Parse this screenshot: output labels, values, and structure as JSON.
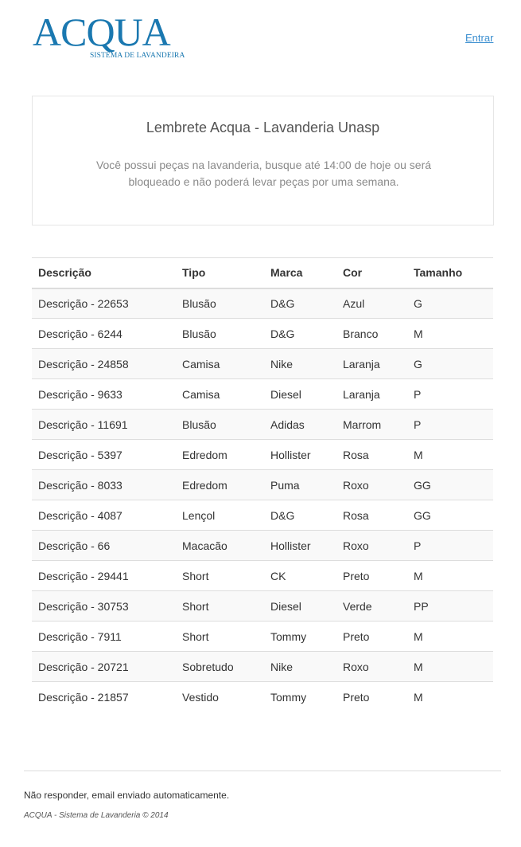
{
  "header": {
    "logo_text": "ACQUA",
    "logo_subtitle": "SISTEMA DE LAVANDEIRA",
    "login_link": "Entrar"
  },
  "notice": {
    "title": "Lembrete Acqua - Lavanderia Unasp",
    "body": "Você possui peças na lavanderia, busque até 14:00 de hoje ou será bloqueado e não poderá levar peças por uma semana."
  },
  "table": {
    "headers": [
      "Descrição",
      "Tipo",
      "Marca",
      "Cor",
      "Tamanho"
    ],
    "rows": [
      [
        "Descrição - 22653",
        "Blusão",
        "D&G",
        "Azul",
        "G"
      ],
      [
        "Descrição - 6244",
        "Blusão",
        "D&G",
        "Branco",
        "M"
      ],
      [
        "Descrição - 24858",
        "Camisa",
        "Nike",
        "Laranja",
        "G"
      ],
      [
        "Descrição - 9633",
        "Camisa",
        "Diesel",
        "Laranja",
        "P"
      ],
      [
        "Descrição - 11691",
        "Blusão",
        "Adidas",
        "Marrom",
        "P"
      ],
      [
        "Descrição - 5397",
        "Edredom",
        "Hollister",
        "Rosa",
        "M"
      ],
      [
        "Descrição - 8033",
        "Edredom",
        "Puma",
        "Roxo",
        "GG"
      ],
      [
        "Descrição - 4087",
        "Lençol",
        "D&G",
        "Rosa",
        "GG"
      ],
      [
        "Descrição - 66",
        "Macacão",
        "Hollister",
        "Roxo",
        "P"
      ],
      [
        "Descrição - 29441",
        "Short",
        "CK",
        "Preto",
        "M"
      ],
      [
        "Descrição - 30753",
        "Short",
        "Diesel",
        "Verde",
        "PP"
      ],
      [
        "Descrição - 7911",
        "Short",
        "Tommy",
        "Preto",
        "M"
      ],
      [
        "Descrição - 20721",
        "Sobretudo",
        "Nike",
        "Roxo",
        "M"
      ],
      [
        "Descrição - 21857",
        "Vestido",
        "Tommy",
        "Preto",
        "M"
      ]
    ]
  },
  "footer": {
    "note": "Não responder, email enviado automaticamente.",
    "copyright": "ACQUA - Sistema de Lavanderia © 2014"
  },
  "colors": {
    "brand": "#1a78b0",
    "link": "#3b8fd0",
    "stripe": "#f9f9f9"
  }
}
